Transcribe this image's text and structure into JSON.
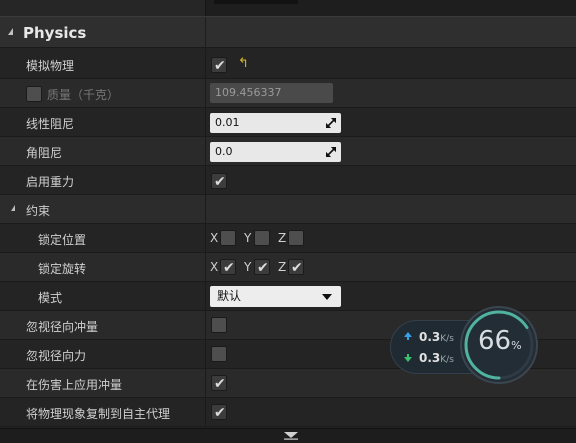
{
  "section": {
    "title": "Physics"
  },
  "rows": {
    "simulate_physics": {
      "label": "模拟物理",
      "checked": true
    },
    "mass": {
      "label": "质量（千克）",
      "value": "109.456337"
    },
    "linear_damping": {
      "label": "线性阻尼",
      "value": "0.01"
    },
    "angular_damping": {
      "label": "角阻尼",
      "value": "0.0"
    },
    "enable_gravity": {
      "label": "启用重力",
      "checked": true
    }
  },
  "constraints": {
    "title": "约束",
    "lock_position": {
      "label": "锁定位置",
      "axes": [
        "X",
        "Y",
        "Z"
      ]
    },
    "lock_rotation": {
      "label": "锁定旋转",
      "axes": [
        "X",
        "Y",
        "Z"
      ]
    },
    "mode": {
      "label": "模式",
      "selected": "默认"
    }
  },
  "more_rows": {
    "ignore_radial_impulse": {
      "label": "忽视径向冲量"
    },
    "ignore_radial_force": {
      "label": "忽视径向力"
    },
    "apply_impulse_on_damage": {
      "label": "在伤害上应用冲量"
    },
    "replicate_physics": {
      "label": "将物理现象复制到自主代理"
    }
  },
  "net_monitor": {
    "upload_value": "0.3",
    "upload_unit": "K/s",
    "download_value": "0.3",
    "download_unit": "K/s",
    "percent": "66",
    "percent_sign": "%",
    "upload_color": "#3aa0e6",
    "download_color": "#3ac26a"
  }
}
